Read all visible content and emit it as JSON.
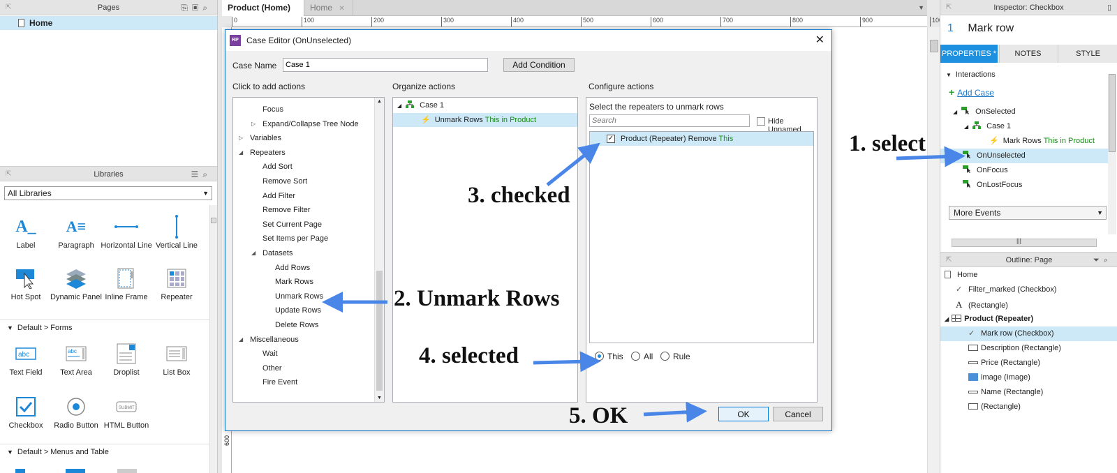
{
  "left": {
    "pages_title": "Pages",
    "page_item": "Home",
    "libraries_title": "Libraries",
    "libraries_select": "All Libraries",
    "widgets_row1": [
      "Label",
      "Paragraph",
      "Horizontal Line",
      "Vertical Line"
    ],
    "widgets_row2": [
      "Hot Spot",
      "Dynamic Panel",
      "Inline Frame",
      "Repeater"
    ],
    "forms_section": "Default > Forms",
    "forms_row1": [
      "Text Field",
      "Text Area",
      "Droplist",
      "List Box"
    ],
    "forms_row2": [
      "Checkbox",
      "Radio Button",
      "HTML Button"
    ],
    "menus_section": "Default > Menus and Table"
  },
  "tabs": [
    {
      "label": "Product (Home)",
      "close": "✕"
    },
    {
      "label": "Home",
      "close": "✕"
    }
  ],
  "ruler_ticks": [
    "0",
    "100",
    "200",
    "300",
    "400",
    "500",
    "600",
    "700",
    "800",
    "900",
    "100"
  ],
  "vruler_label": "600",
  "dialog": {
    "title": "Case Editor (OnUnselected)",
    "case_name_label": "Case Name",
    "case_name_value": "Case 1",
    "add_condition": "Add Condition",
    "col1_header": "Click to add actions",
    "col2_header": "Organize actions",
    "col3_header": "Configure actions",
    "actions": [
      {
        "label": "Focus",
        "indent": 1
      },
      {
        "label": "Expand/Collapse Tree Node",
        "indent": 1,
        "collapsed": true
      },
      {
        "label": "Variables",
        "indent": 0,
        "collapsed": true
      },
      {
        "label": "Repeaters",
        "indent": 0,
        "expanded": true
      },
      {
        "label": "Add Sort",
        "indent": 1
      },
      {
        "label": "Remove Sort",
        "indent": 1
      },
      {
        "label": "Add Filter",
        "indent": 1
      },
      {
        "label": "Remove Filter",
        "indent": 1
      },
      {
        "label": "Set Current Page",
        "indent": 1
      },
      {
        "label": "Set Items per Page",
        "indent": 1
      },
      {
        "label": "Datasets",
        "indent": 1,
        "expanded": true
      },
      {
        "label": "Add Rows",
        "indent": 2
      },
      {
        "label": "Mark Rows",
        "indent": 2
      },
      {
        "label": "Unmark Rows",
        "indent": 2
      },
      {
        "label": "Update Rows",
        "indent": 2
      },
      {
        "label": "Delete Rows",
        "indent": 2
      },
      {
        "label": "Miscellaneous",
        "indent": 0,
        "expanded": true
      },
      {
        "label": "Wait",
        "indent": 1
      },
      {
        "label": "Other",
        "indent": 1
      },
      {
        "label": "Fire Event",
        "indent": 1
      }
    ],
    "organize_case": "Case 1",
    "organize_action": "Unmark Rows",
    "organize_action_target": "This in Product",
    "configure_hint": "Select the repeaters to unmark rows",
    "search_placeholder": "Search",
    "hide_unnamed": "Hide Unnamed",
    "repeater_row": "Product (Repeater) Remove",
    "repeater_row_target": "This",
    "radio_this": "This",
    "radio_all": "All",
    "radio_rule": "Rule",
    "ok": "OK",
    "cancel": "Cancel",
    "close": "✕"
  },
  "annotations": {
    "a1": "1. select",
    "a2": "2. Unmark Rows",
    "a3": "3. checked",
    "a4": "4. selected",
    "a5": "5. OK"
  },
  "inspector": {
    "title": "Inspector: Checkbox",
    "widget_number": "1",
    "widget_name": "Mark row",
    "tabs": [
      "PROPERTIES *",
      "NOTES",
      "STYLE"
    ],
    "interactions_label": "Interactions",
    "add_case": "Add Case",
    "on_selected": "OnSelected",
    "case1": "Case 1",
    "mark_rows": "Mark Rows",
    "mark_rows_target": "This in Product",
    "on_unselected": "OnUnselected",
    "on_focus": "OnFocus",
    "on_lost_focus": "OnLostFocus",
    "more_events": "More Events"
  },
  "outline": {
    "title": "Outline: Page",
    "items": [
      {
        "label": "Home",
        "icon": "page-icon",
        "indent": 0
      },
      {
        "label": "Filter_marked (Checkbox)",
        "icon": "check-icon",
        "indent": 1
      },
      {
        "label": "(Rectangle)",
        "icon": "text-icon",
        "indent": 1
      },
      {
        "label": "Product (Repeater)",
        "icon": "repeater-icon",
        "indent": 0,
        "bold": true
      },
      {
        "label": "Mark row (Checkbox)",
        "icon": "check-icon",
        "indent": 2,
        "selected": true
      },
      {
        "label": "Description (Rectangle)",
        "icon": "rect-icon",
        "indent": 2
      },
      {
        "label": "Price (Rectangle)",
        "icon": "line-icon",
        "indent": 2
      },
      {
        "label": "image (Image)",
        "icon": "image-icon",
        "indent": 2
      },
      {
        "label": "Name (Rectangle)",
        "icon": "line-icon",
        "indent": 2
      },
      {
        "label": "(Rectangle)",
        "icon": "rect-icon",
        "indent": 2
      }
    ]
  },
  "colors": {
    "accent": "#1e90e0",
    "selection": "#cde8f6",
    "arrow": "#4a86e8",
    "green": "#1a8a1a"
  }
}
